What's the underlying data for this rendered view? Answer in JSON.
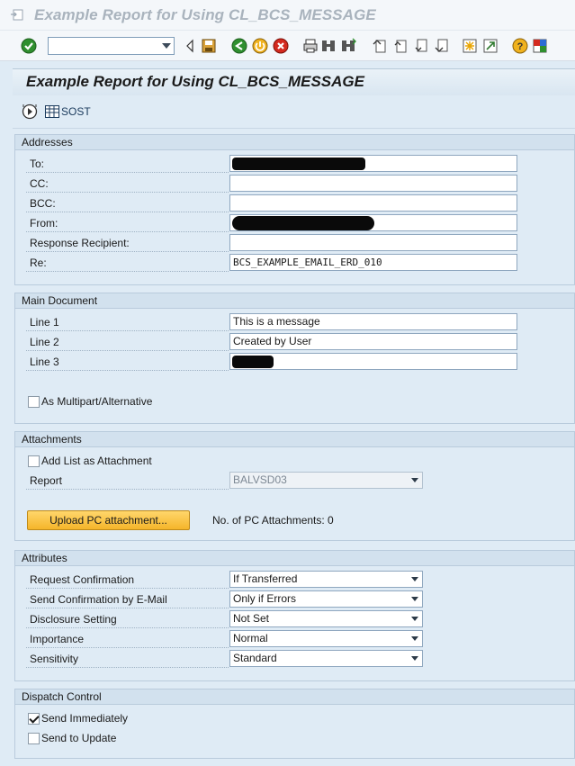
{
  "window": {
    "title": "Example Report for Using CL_BCS_MESSAGE"
  },
  "toolbar": {
    "command_value": ""
  },
  "header": {
    "title": "Example Report for Using CL_BCS_MESSAGE"
  },
  "appbar": {
    "sost_label": "SOST"
  },
  "addresses": {
    "title": "Addresses",
    "to_label": "To:",
    "cc_label": "CC:",
    "bcc_label": "BCC:",
    "from_label": "From:",
    "response_label": "Response Recipient:",
    "re_label": "Re:",
    "re_value": "BCS_EXAMPLE_EMAIL_ERD_010"
  },
  "main_document": {
    "title": "Main Document",
    "line1_label": "Line 1",
    "line1_value": "This is a message",
    "line2_label": "Line 2",
    "line2_value": "Created by User",
    "line3_label": "Line 3",
    "multipart_label": "As Multipart/Alternative",
    "multipart_checked": false
  },
  "attachments": {
    "title": "Attachments",
    "add_list_label": "Add List as Attachment",
    "add_list_checked": false,
    "report_label": "Report",
    "report_value": "BALVSD03",
    "upload_label": "Upload PC attachment...",
    "pc_count_text": "No. of PC Attachments: 0"
  },
  "attributes": {
    "title": "Attributes",
    "rows": [
      {
        "label": "Request Confirmation",
        "value": "If Transferred"
      },
      {
        "label": "Send Confirmation by E-Mail",
        "value": "Only if Errors"
      },
      {
        "label": "Disclosure Setting",
        "value": "Not Set"
      },
      {
        "label": "Importance",
        "value": "Normal"
      },
      {
        "label": "Sensitivity",
        "value": "Standard"
      }
    ]
  },
  "dispatch": {
    "title": "Dispatch Control",
    "send_immediately_label": "Send Immediately",
    "send_immediately_checked": true,
    "send_update_label": "Send to Update",
    "send_update_checked": false
  },
  "colors": {
    "background": "#dfebf5",
    "accent_button": "#f5b52a",
    "group_title": "#d2e1ee"
  }
}
